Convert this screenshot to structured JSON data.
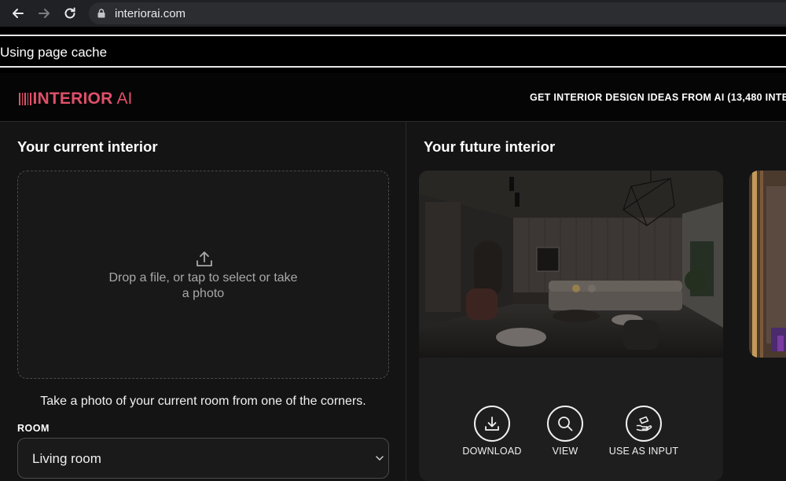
{
  "browser": {
    "url": "interiorai.com",
    "cache_notice": "Using page cache"
  },
  "header": {
    "logo_word": "INTERIOR",
    "logo_suffix": "AI",
    "tagline": "GET INTERIOR DESIGN IDEAS FROM AI (13,480 INTE",
    "brand_color": "#e0506a"
  },
  "left": {
    "title": "Your current interior",
    "dropzone_text": "Drop a file, or tap to select or take a photo",
    "hint": "Take a photo of your current room from one of the corners.",
    "room_label": "ROOM",
    "room_value": "Living room"
  },
  "right": {
    "title": "Your future interior",
    "actions": [
      {
        "label": "DOWNLOAD",
        "icon": "download-icon"
      },
      {
        "label": "VIEW",
        "icon": "search-icon"
      },
      {
        "label": "USE AS INPUT",
        "icon": "use-as-input-icon"
      }
    ]
  }
}
